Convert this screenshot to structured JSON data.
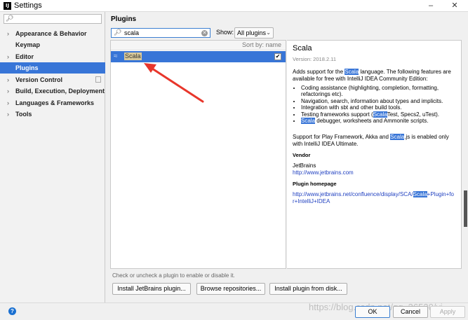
{
  "window": {
    "app_icon": "IJ",
    "title": "Settings",
    "minimize": "–",
    "close": "✕"
  },
  "sidebar": {
    "search_value": "",
    "items": [
      {
        "label": "Appearance & Behavior",
        "arrow": "›"
      },
      {
        "label": "Keymap",
        "arrow": ""
      },
      {
        "label": "Editor",
        "arrow": "›"
      },
      {
        "label": "Plugins",
        "arrow": ""
      },
      {
        "label": "Version Control",
        "arrow": "›"
      },
      {
        "label": "Build, Execution, Deployment",
        "arrow": "›"
      },
      {
        "label": "Languages & Frameworks",
        "arrow": "›"
      },
      {
        "label": "Tools",
        "arrow": "›"
      }
    ]
  },
  "plugins": {
    "title": "Plugins",
    "search_value": "scala",
    "show_label": "Show:",
    "show_selected": "All plugins",
    "sort_label": "Sort by: name",
    "list": [
      {
        "name": "Scala",
        "enabled": true
      }
    ]
  },
  "detail": {
    "name": "Scala",
    "version": "Version: 2018.2.11",
    "desc_pre": "Adds support for the ",
    "desc_hl": "Scala",
    "desc_post": " language. The following features are available for free with IntelliJ IDEA Community Edition:",
    "features": [
      {
        "pre": "Coding assistance (highlighting, completion, formatting, refactorings etc).",
        "hl": "",
        "post": ""
      },
      {
        "pre": "Navigation, search, information about types and implicits.",
        "hl": "",
        "post": ""
      },
      {
        "pre": "Integration with sbt and other build tools.",
        "hl": "",
        "post": ""
      },
      {
        "pre": "Testing frameworks support (",
        "hl": "Scala",
        "post": "Test, Specs2, uTest)."
      },
      {
        "pre": "",
        "hl": "Scala",
        "post": " debugger, worksheets and Ammonite scripts."
      }
    ],
    "support_pre": "Support for Play Framework, Akka and ",
    "support_hl": "Scala",
    "support_post": ".js is enabled only with IntelliJ IDEA Ultimate.",
    "vendor_head": "Vendor",
    "vendor_name": "JetBrains",
    "vendor_url": "http://www.jetbrains.com",
    "homepage_head": "Plugin homepage",
    "homepage_pre": "http://www.jetbrains.net/confluence/display/SCA/",
    "homepage_hl": "Scala",
    "homepage_post": "+Plugin+for+IntelliJ+IDEA"
  },
  "hint": "Check or uncheck a plugin to enable or disable it.",
  "buttons": {
    "install_jb": "Install JetBrains plugin...",
    "browse": "Browse repositories...",
    "from_disk": "Install plugin from disk...",
    "ok": "OK",
    "cancel": "Cancel",
    "apply": "Apply",
    "help": "?"
  },
  "watermark": "https://blog.csdn.net/qq_36520/vi"
}
